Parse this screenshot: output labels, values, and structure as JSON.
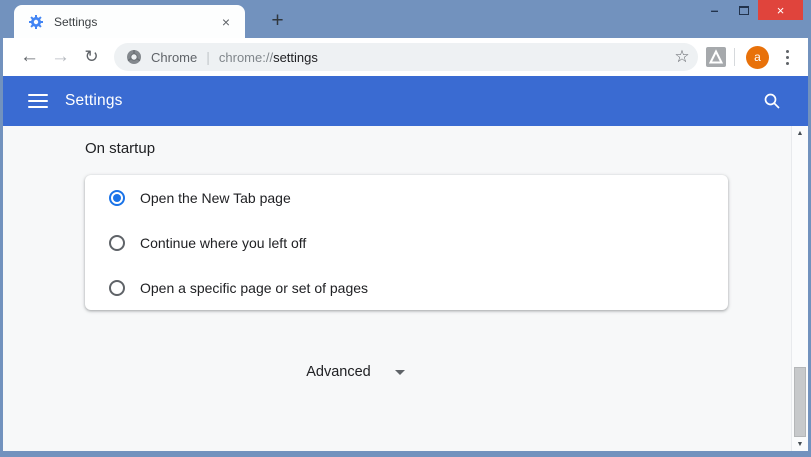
{
  "titlebar": {
    "tab": {
      "title": "Settings",
      "close_glyph": "×"
    },
    "new_tab_glyph": "+",
    "controls": {
      "minimize_glyph": "–",
      "close_glyph": "×"
    }
  },
  "navbar": {
    "back_glyph": "←",
    "forward_glyph": "→",
    "reload_glyph": "↻",
    "omnibox": {
      "site_label": "Chrome",
      "divider_glyph": "|",
      "url_scheme": "chrome://",
      "url_path": "settings",
      "star_glyph": "☆"
    },
    "avatar_letter": "a"
  },
  "app_header": {
    "title": "Settings"
  },
  "content": {
    "section_heading": "On startup",
    "options": [
      {
        "label": "Open the New Tab page",
        "selected": true
      },
      {
        "label": "Continue where you left off",
        "selected": false
      },
      {
        "label": "Open a specific page or set of pages",
        "selected": false
      }
    ],
    "advanced_label": "Advanced"
  },
  "scrollbar": {
    "up_glyph": "▲",
    "down_glyph": "▼"
  },
  "colors": {
    "titlebar": "#7292be",
    "header_blue": "#3a6bd2",
    "close_red": "#e0443c",
    "radio_selected": "#1a73e8",
    "avatar_orange": "#e8710a",
    "favicon_blue": "#4285f4"
  }
}
